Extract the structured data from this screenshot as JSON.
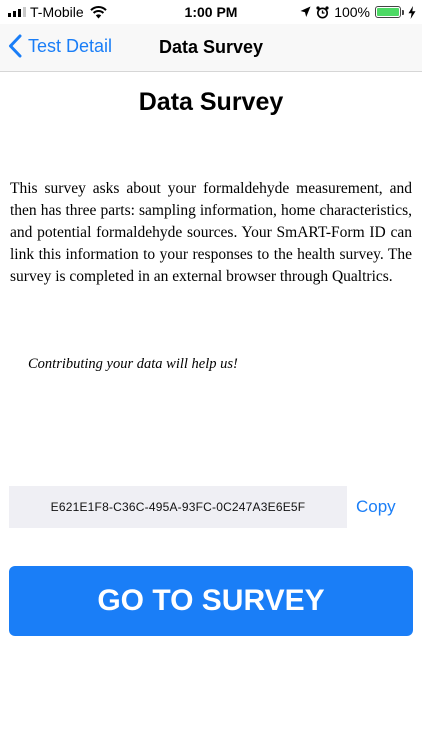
{
  "status_bar": {
    "carrier": "T-Mobile",
    "time": "1:00 PM",
    "battery_percent": "100%",
    "battery_level": 1.0,
    "signal_bars_filled": 3,
    "signal_bars_total": 4,
    "icons": [
      "signal-icon",
      "wifi-icon",
      "location-icon",
      "alarm-icon",
      "battery-icon",
      "charging-icon"
    ]
  },
  "nav": {
    "back_label": "Test Detail",
    "title": "Data Survey"
  },
  "page": {
    "heading": "Data Survey",
    "description": "This survey asks about your formaldehyde measurement, and then has three parts: sampling information, home characteristics, and potential formaldehyde sources. Your SmART-Form ID can link this information to your responses to the health survey. The survey is completed in an external browser through Qualtrics.",
    "encourage": "Contributing your data will help us!",
    "form_id": "E621E1F8-C36C-495A-93FC-0C247A3E6E5F",
    "copy_label": "Copy",
    "go_button_label": "GO TO SURVEY"
  },
  "colors": {
    "accent": "#1a7ef7",
    "id_field_bg": "#efeff4",
    "battery": "#4cd964"
  }
}
